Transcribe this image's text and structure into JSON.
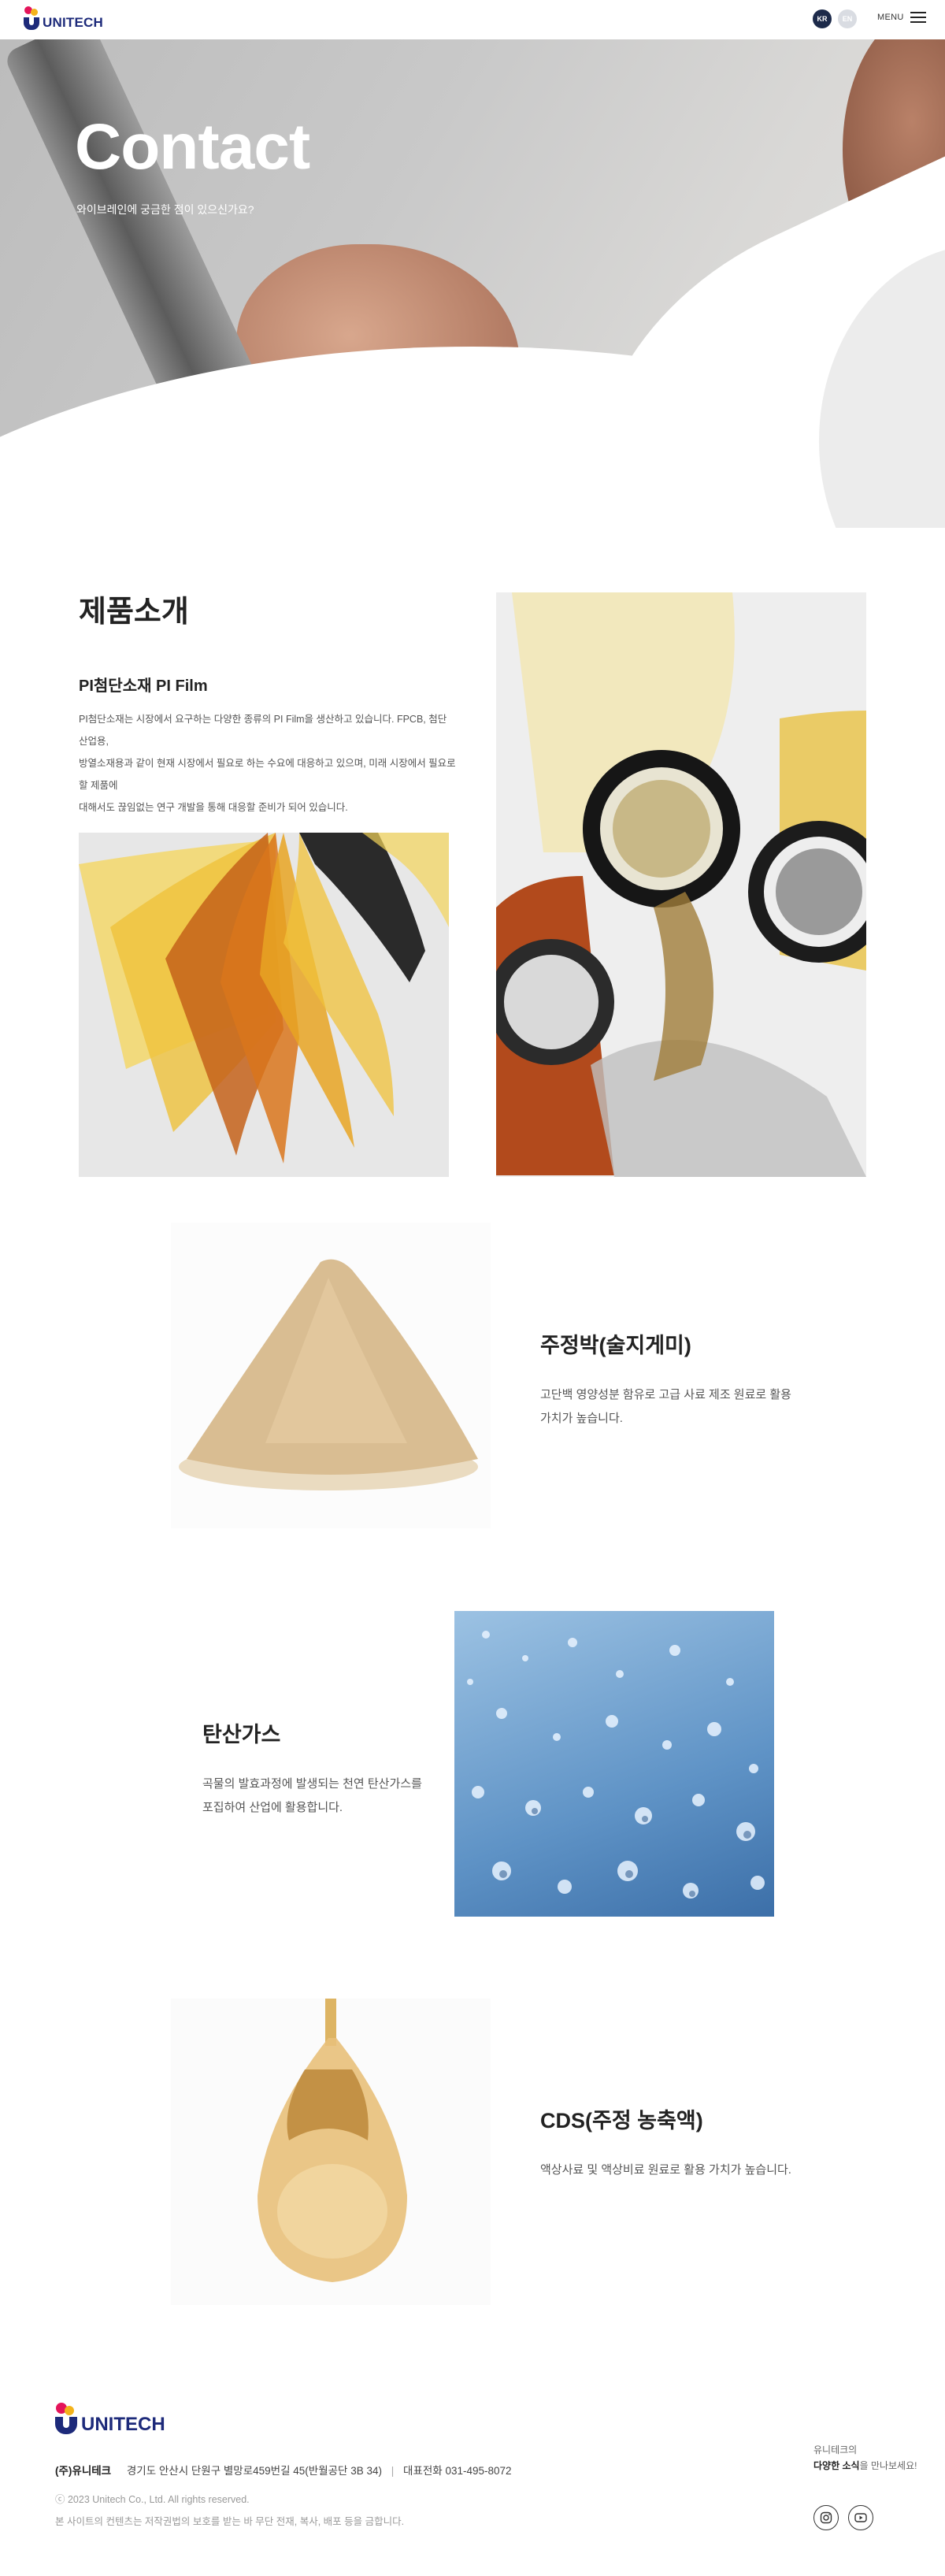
{
  "header": {
    "logo_text": "UNITECH",
    "lang_kr": "KR",
    "lang_en": "EN",
    "menu_label": "MENU"
  },
  "hero": {
    "title": "Contact",
    "subtitle": "와이브레인에 궁금한 점이 있으신가요?"
  },
  "products": {
    "section_title": "제품소개",
    "pi": {
      "title": "PI첨단소재 PI Film",
      "desc_line1": "PI첨단소재는 시장에서 요구하는 다양한 종류의 PI Film을 생산하고 있습니다. FPCB, 첨단 산업용,",
      "desc_line2": "방열소재용과 같이 현재 시장에서 필요로 하는 수요에 대응하고 있으며, 미래 시장에서 필요로 할 제품에",
      "desc_line3": "대해서도 끊임없는 연구 개발을 통해 대응할 준비가 되어 있습니다."
    },
    "item1": {
      "title": "주정박(술지게미)",
      "desc_line1": "고단백 영양성분 함유로 고급 사료 제조 원료로 활용",
      "desc_line2": "가치가 높습니다."
    },
    "item2": {
      "title": "탄산가스",
      "desc_line1": "곡물의 발효과정에 발생되는 천연 탄산가스를",
      "desc_line2": "포집하여 산업에 활용합니다."
    },
    "item3": {
      "title": "CDS(주정 농축액)",
      "desc_line1": "액상사료 및 액상비료 원료로 활용 가치가 높습니다."
    }
  },
  "footer": {
    "logo_text": "UNITECH",
    "company": "(주)유니테크",
    "address": "경기도 안산시 단원구 별망로459번길 45(반월공단 3B 34)",
    "phone": "대표전화 031-495-8072",
    "copyright": "ⓒ 2023 Unitech Co., Ltd. All rights reserved.",
    "notice": "본 사이트의 컨텐츠는 저작권법의 보호를 받는 바 무단 전재, 복사, 배포 등을 금합니다.",
    "cta_line1": "유니테크의",
    "cta_strong": "다양한 소식",
    "cta_rest": "을 만나보세요!",
    "instagram_icon": "instagram-icon",
    "youtube_icon": "youtube-icon"
  }
}
